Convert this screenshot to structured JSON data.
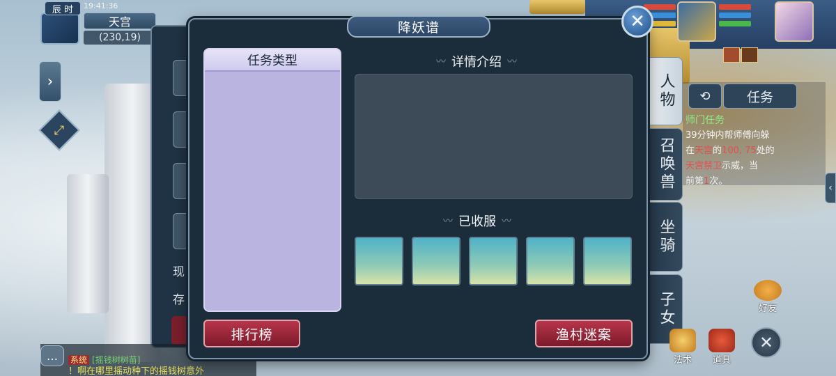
{
  "hud": {
    "time_badge": "辰 时",
    "clock": "19:41:36",
    "map_name": "天宫",
    "coords": "(230,19)"
  },
  "bag_partial": {
    "text_1": "现",
    "text_2": "存"
  },
  "modal": {
    "title": "降妖谱",
    "type_list_header": "任务类型",
    "detail_label": "详情介绍",
    "captured_label": "已收服",
    "captured_slots": 5,
    "ranking_button": "排行榜",
    "case_button": "渔村迷案",
    "close_glyph": "✕"
  },
  "right_tabs": [
    {
      "label": "人物"
    },
    {
      "label": "召唤兽"
    },
    {
      "label": "坐骑"
    },
    {
      "label": "子女"
    }
  ],
  "task_panel": {
    "history_glyph": "⟲",
    "tab_label": "任务",
    "title": "师门任务",
    "text_a": "39分钟内帮师傅向躲",
    "text_b": "在",
    "text_red1": "天宫",
    "text_c": "的",
    "text_red2": "100, 75",
    "text_d": "处的",
    "text_red3": "天宫禁卫",
    "text_e": "示威，当",
    "text_f": "前第",
    "text_red4": "1",
    "text_g": "次。"
  },
  "bottom": {
    "friends": "好友",
    "magic": "法术",
    "items": "道具",
    "close_glyph": "✕"
  },
  "chat": {
    "sys_tag": "系统",
    "line1": "[摇钱树树苗]",
    "line2": "！啊在哪里摇动种下的摇钱树意外"
  },
  "colors": {
    "modal_bg": "#1b2c3b",
    "type_list_bg": "#b9b4e0",
    "red_button": "#9a2a3c",
    "task_green": "#8ef08a"
  }
}
